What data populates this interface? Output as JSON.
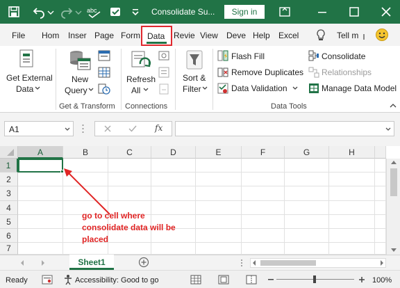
{
  "window": {
    "title": "Consolidate Su...",
    "signin_label": "Sign in"
  },
  "menu": {
    "tabs": [
      "File",
      "Hom",
      "Inser",
      "Page",
      "Form",
      "Data",
      "Revie",
      "View",
      "Deve",
      "Help",
      "Excel",
      "Tell m"
    ],
    "active_tab": "Data"
  },
  "ribbon": {
    "get_external_1": "Get External",
    "get_external_2": "Data",
    "new_query_1": "New",
    "new_query_2": "Query",
    "refresh_1": "Refresh",
    "refresh_2": "All",
    "sort_filter_1": "Sort &",
    "sort_filter_2": "Filter",
    "flash_fill": "Flash Fill",
    "remove_duplicates": "Remove Duplicates",
    "data_validation": "Data Validation",
    "consolidate": "Consolidate",
    "relationships": "Relationships",
    "manage_data_model": "Manage Data Model",
    "groups": {
      "get_transform": "Get & Transform",
      "connections": "Connections",
      "data_tools": "Data Tools"
    }
  },
  "formula_bar": {
    "name_box": "A1",
    "fx_label": "fx",
    "value": ""
  },
  "grid": {
    "columns": [
      "A",
      "B",
      "C",
      "D",
      "E",
      "F",
      "G",
      "H"
    ],
    "rows": [
      "1",
      "2",
      "3",
      "4",
      "5",
      "6",
      "7"
    ],
    "active_cell": "A1"
  },
  "annotation": {
    "text": "go to cell where consolidate data will be placed",
    "color": "#e02424"
  },
  "sheets": {
    "tabs": [
      "Sheet1"
    ],
    "active": "Sheet1"
  },
  "status": {
    "ready": "Ready",
    "accessibility": "Accessibility: Good to go",
    "zoom": "100%"
  },
  "colors": {
    "accent": "#217346",
    "highlight_box": "#e0282e"
  }
}
